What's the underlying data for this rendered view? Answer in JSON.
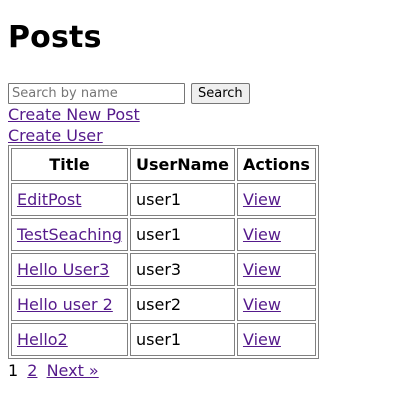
{
  "page": {
    "title": "Posts"
  },
  "search": {
    "placeholder": "Search by name",
    "value": "",
    "button_label": "Search"
  },
  "links": {
    "create_post": "Create New Post",
    "create_user": "Create User"
  },
  "table": {
    "headers": [
      "Title",
      "UserName",
      "Actions"
    ],
    "rows": [
      {
        "title": "EditPost",
        "username": "user1",
        "action": "View"
      },
      {
        "title": "TestSeaching",
        "username": "user1",
        "action": "View"
      },
      {
        "title": "Hello User3",
        "username": "user3",
        "action": "View"
      },
      {
        "title": "Hello user 2",
        "username": "user2",
        "action": "View"
      },
      {
        "title": "Hello2",
        "username": "user1",
        "action": "View"
      }
    ]
  },
  "pagination": {
    "current": "1",
    "page2": "2",
    "next": "Next »"
  },
  "colors": {
    "link": "#551a8b",
    "border": "#808080",
    "button_bg": "#efefef"
  }
}
